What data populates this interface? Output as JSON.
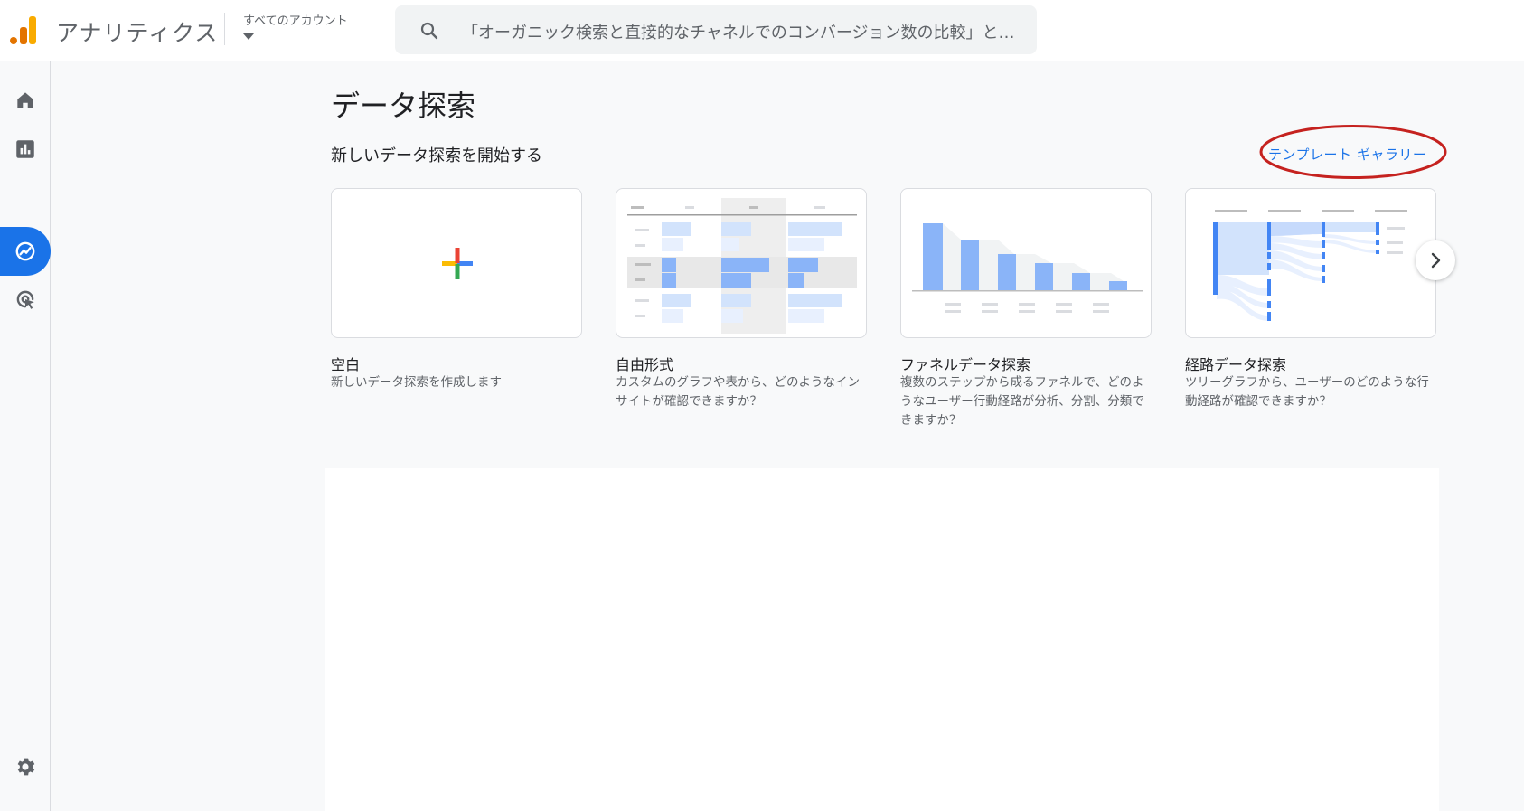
{
  "header": {
    "app_title": "アナリティクス",
    "account_label": "すべてのアカウント",
    "search_placeholder": "「オーガニック検索と直接的なチャネルでのコンバージョン数の比較」と検索してみてください"
  },
  "rail": {
    "items": [
      {
        "name": "home-icon",
        "active": false
      },
      {
        "name": "reports-icon",
        "active": false
      },
      {
        "name": "explore-icon",
        "active": true
      },
      {
        "name": "advertising-icon",
        "active": false
      }
    ],
    "settings_icon": "gear-icon"
  },
  "main": {
    "title": "データ探索",
    "section_label": "新しいデータ探索を開始する",
    "gallery_link": "テンプレート ギャラリー",
    "cards": [
      {
        "title": "空白",
        "description": "新しいデータ探索を作成します"
      },
      {
        "title": "自由形式",
        "description": "カスタムのグラフや表から、どのようなインサイトが確認できますか？"
      },
      {
        "title": "ファネルデータ探索",
        "description": "複数のステップから成るファネルで、どのようなユーザー行動経路が分析、分割、分類できますか？"
      },
      {
        "title": "経路データ探索",
        "description": "ツリーグラフから、ユーザーのどのような行動経路が確認できますか？"
      }
    ]
  },
  "colors": {
    "accent": "#1a73e8",
    "annotation": "#c5221f",
    "chart_bar": "#8ab4f8",
    "chart_bar_light": "#d2e3fc"
  }
}
